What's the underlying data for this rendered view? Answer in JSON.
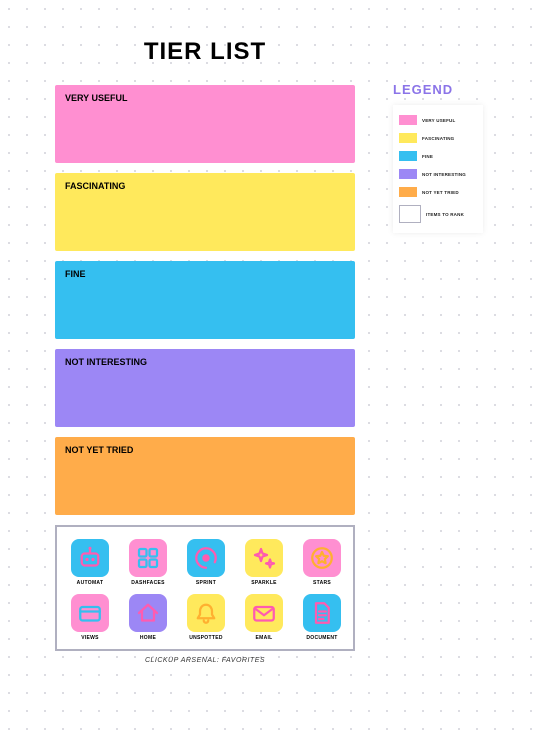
{
  "title": "TIER LIST",
  "tiers": [
    {
      "label": "VERY USEFUL",
      "color": "#ff8fd1"
    },
    {
      "label": "FASCINATING",
      "color": "#ffe95c"
    },
    {
      "label": "FINE",
      "color": "#35bff0"
    },
    {
      "label": "NOT INTERESTING",
      "color": "#9c87f5"
    },
    {
      "label": "NOT YET TRIED",
      "color": "#ffac4a"
    }
  ],
  "arsenal": {
    "caption": "CLICKUP ARSENAL: FAVORITES",
    "items": [
      {
        "label": "AUTOMAT",
        "icon": "robot-icon",
        "bg": "#35bff0",
        "fg": "#ff5bb0"
      },
      {
        "label": "DASHFACES",
        "icon": "grid-icon",
        "bg": "#ff8fd1",
        "fg": "#35bff0"
      },
      {
        "label": "SPRINT",
        "icon": "target-icon",
        "bg": "#35bff0",
        "fg": "#ff5bb0"
      },
      {
        "label": "SPARKLE",
        "icon": "sparkle-icon",
        "bg": "#ffe95c",
        "fg": "#ff5bb0"
      },
      {
        "label": "STARS",
        "icon": "star-icon",
        "bg": "#ff8fd1",
        "fg": "#ffb030"
      },
      {
        "label": "VIEWS",
        "icon": "card-icon",
        "bg": "#ff8fd1",
        "fg": "#35bff0"
      },
      {
        "label": "HOME",
        "icon": "home-icon",
        "bg": "#9c87f5",
        "fg": "#ff5bb0"
      },
      {
        "label": "UNSPOTTED",
        "icon": "bell-icon",
        "bg": "#ffe95c",
        "fg": "#ffb030"
      },
      {
        "label": "EMAIL",
        "icon": "mail-icon",
        "bg": "#ffe95c",
        "fg": "#ff5bb0"
      },
      {
        "label": "DOCUMENT",
        "icon": "doc-icon",
        "bg": "#35bff0",
        "fg": "#ff5bb0"
      }
    ]
  },
  "legend": {
    "title": "LEGEND",
    "items": [
      {
        "label": "VERY USEFUL",
        "color": "#ff8fd1"
      },
      {
        "label": "FASCINATING",
        "color": "#ffe95c"
      },
      {
        "label": "FINE",
        "color": "#35bff0"
      },
      {
        "label": "NOT INTERESTING",
        "color": "#9c87f5"
      },
      {
        "label": "NOT YET TRIED",
        "color": "#ffac4a"
      }
    ],
    "placeholder_label": "ITEMS TO RANK"
  }
}
